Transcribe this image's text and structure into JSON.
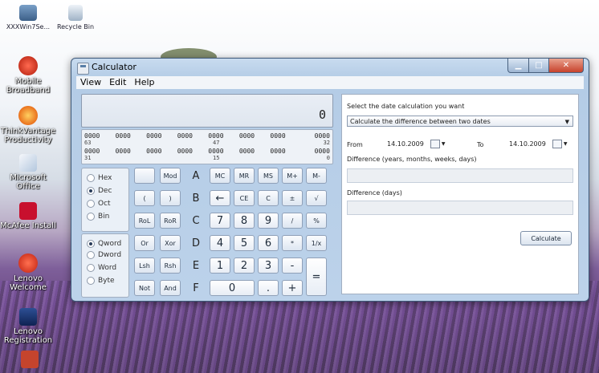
{
  "desktop": {
    "icons": [
      {
        "label": "XXXWin7Se...",
        "icon": "computer-icon"
      },
      {
        "label": "Recycle Bin",
        "icon": "recycle-bin-icon"
      },
      {
        "label": "Mobile Broadband",
        "icon": "mobile-broadband-icon"
      },
      {
        "label": "ThinkVantage Productivity",
        "icon": "thinkvantage-icon"
      },
      {
        "label": "Microsoft Office",
        "icon": "office-icon"
      },
      {
        "label": "McAfee Install",
        "icon": "mcafee-icon"
      },
      {
        "label": "Lenovo Welcome",
        "icon": "lenovo-welcome-icon"
      },
      {
        "label": "Lenovo Registration",
        "icon": "lenovo-registration-icon"
      }
    ]
  },
  "window": {
    "title": "Calculator",
    "menu": [
      "View",
      "Edit",
      "Help"
    ]
  },
  "calculator": {
    "display_value": "0",
    "bits": {
      "row1": [
        "0000",
        "0000",
        "0000",
        "0000",
        "0000",
        "0000",
        "0000",
        "0000"
      ],
      "row1_index": [
        "63",
        "47",
        "32"
      ],
      "row2": [
        "0000",
        "0000",
        "0000",
        "0000",
        "0000",
        "0000",
        "0000",
        "0000"
      ],
      "row2_index": [
        "31",
        "15",
        "0"
      ]
    },
    "base_options": [
      {
        "label": "Hex",
        "selected": false
      },
      {
        "label": "Dec",
        "selected": true
      },
      {
        "label": "Oct",
        "selected": false
      },
      {
        "label": "Bin",
        "selected": false
      }
    ],
    "word_options": [
      {
        "label": "Qword",
        "selected": true
      },
      {
        "label": "Dword",
        "selected": false
      },
      {
        "label": "Word",
        "selected": false
      },
      {
        "label": "Byte",
        "selected": false
      }
    ],
    "keys": {
      "mod": "Mod",
      "A": "A",
      "MC": "MC",
      "MR": "MR",
      "MS": "MS",
      "Mplus": "M+",
      "Mminus": "M-",
      "lparen": "(",
      "rparen": ")",
      "B": "B",
      "back": "←",
      "CE": "CE",
      "C": "C",
      "plusminus": "±",
      "sqrt": "√",
      "RoL": "RoL",
      "RoR": "RoR",
      "Ckey": "C",
      "n7": "7",
      "n8": "8",
      "n9": "9",
      "divide": "/",
      "percent": "%",
      "Or": "Or",
      "Xor": "Xor",
      "D": "D",
      "n4": "4",
      "n5": "5",
      "n6": "6",
      "multiply": "*",
      "reciprocal": "1/x",
      "Lsh": "Lsh",
      "Rsh": "Rsh",
      "E": "E",
      "n1": "1",
      "n2": "2",
      "n3": "3",
      "minus": "-",
      "equals": "=",
      "Not": "Not",
      "And": "And",
      "F": "F",
      "n0": "0",
      "dot": ".",
      "plus": "+"
    }
  },
  "date_calc": {
    "prompt": "Select the date calculation you want",
    "mode": "Calculate the difference between two dates",
    "from_label": "From",
    "from_date": "14.10.2009",
    "to_label": "To",
    "to_date": "14.10.2009",
    "diff_label": "Difference (years, months, weeks, days)",
    "diff_days_label": "Difference (days)",
    "calculate_label": "Calculate"
  }
}
